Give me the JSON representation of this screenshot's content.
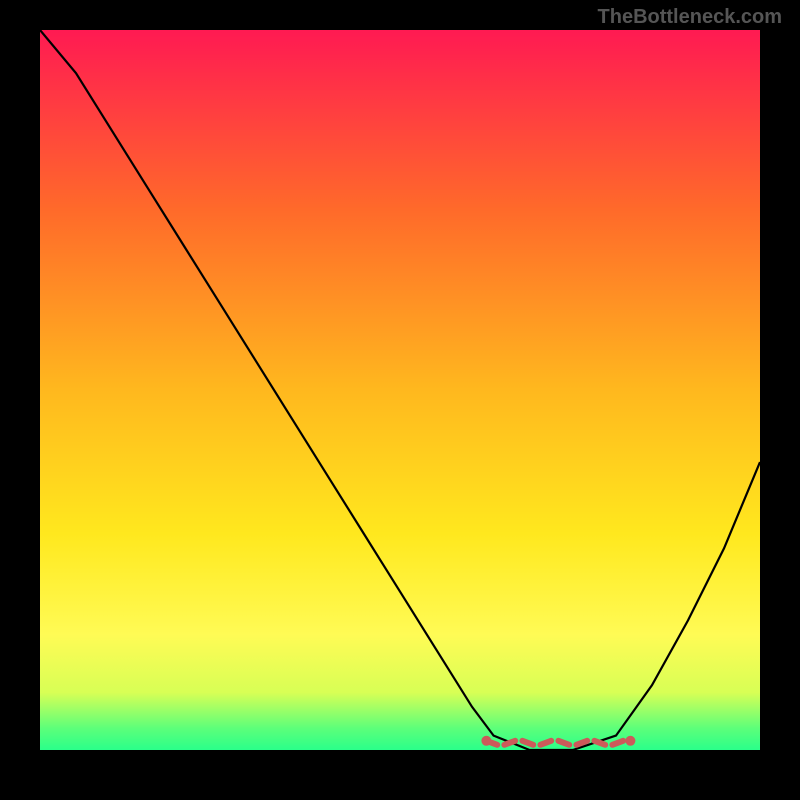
{
  "watermark": "TheBottleneck.com",
  "chart_data": {
    "type": "line",
    "title": "",
    "xlabel": "",
    "ylabel": "",
    "xlim": [
      0,
      100
    ],
    "ylim": [
      0,
      100
    ],
    "grid": false,
    "legend": false,
    "gradient_stops": [
      {
        "offset": 0.0,
        "color": "#ff1a52"
      },
      {
        "offset": 0.25,
        "color": "#ff6a2a"
      },
      {
        "offset": 0.5,
        "color": "#ffb81e"
      },
      {
        "offset": 0.7,
        "color": "#ffe81e"
      },
      {
        "offset": 0.84,
        "color": "#fffb55"
      },
      {
        "offset": 0.92,
        "color": "#d8ff55"
      },
      {
        "offset": 0.97,
        "color": "#5cff7a"
      },
      {
        "offset": 1.0,
        "color": "#2aff8a"
      }
    ],
    "series": [
      {
        "name": "curve",
        "color": "#000000",
        "x": [
          0,
          5,
          10,
          15,
          20,
          25,
          30,
          35,
          40,
          45,
          50,
          55,
          60,
          63,
          68,
          74,
          80,
          85,
          90,
          95,
          100
        ],
        "y": [
          100,
          94,
          86,
          78,
          70,
          62,
          54,
          46,
          38,
          30,
          22,
          14,
          6,
          2,
          0,
          0,
          2,
          9,
          18,
          28,
          40
        ]
      }
    ],
    "highlight_band": {
      "color": "#cc5a5a",
      "x_start": 62,
      "x_end": 82,
      "y_level": 1
    }
  }
}
